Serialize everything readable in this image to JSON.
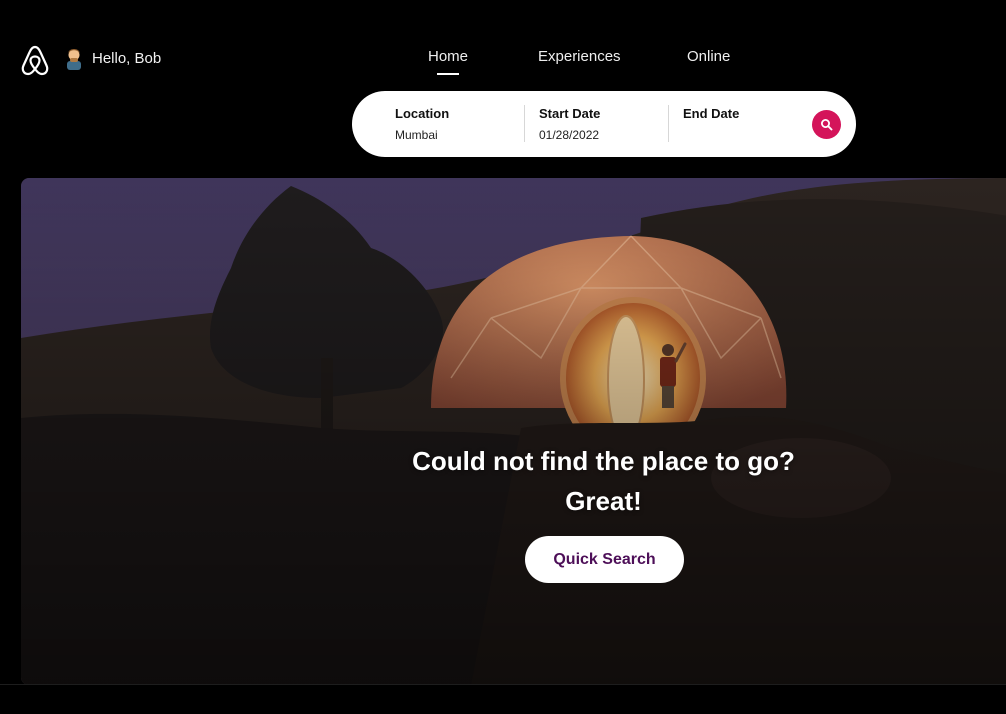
{
  "header": {
    "greeting": "Hello, Bob",
    "logo_icon": "airbnb-logo-icon",
    "avatar_icon": "person-avatar-icon"
  },
  "nav": {
    "items": [
      {
        "label": "Home",
        "active": true
      },
      {
        "label": "Experiences",
        "active": false
      },
      {
        "label": "Online",
        "active": false
      }
    ]
  },
  "search": {
    "location_label": "Location",
    "location_value": "Mumbai",
    "start_label": "Start Date",
    "start_value": "01/28/2022",
    "end_label": "End Date",
    "end_value": "",
    "button_icon": "search-icon",
    "button_color": "#d4145a"
  },
  "hero": {
    "headline_line1": "Could not find the place to go?",
    "headline_line2": "Great!",
    "cta_label": "Quick Search",
    "cta_color": "#4d0f58"
  }
}
